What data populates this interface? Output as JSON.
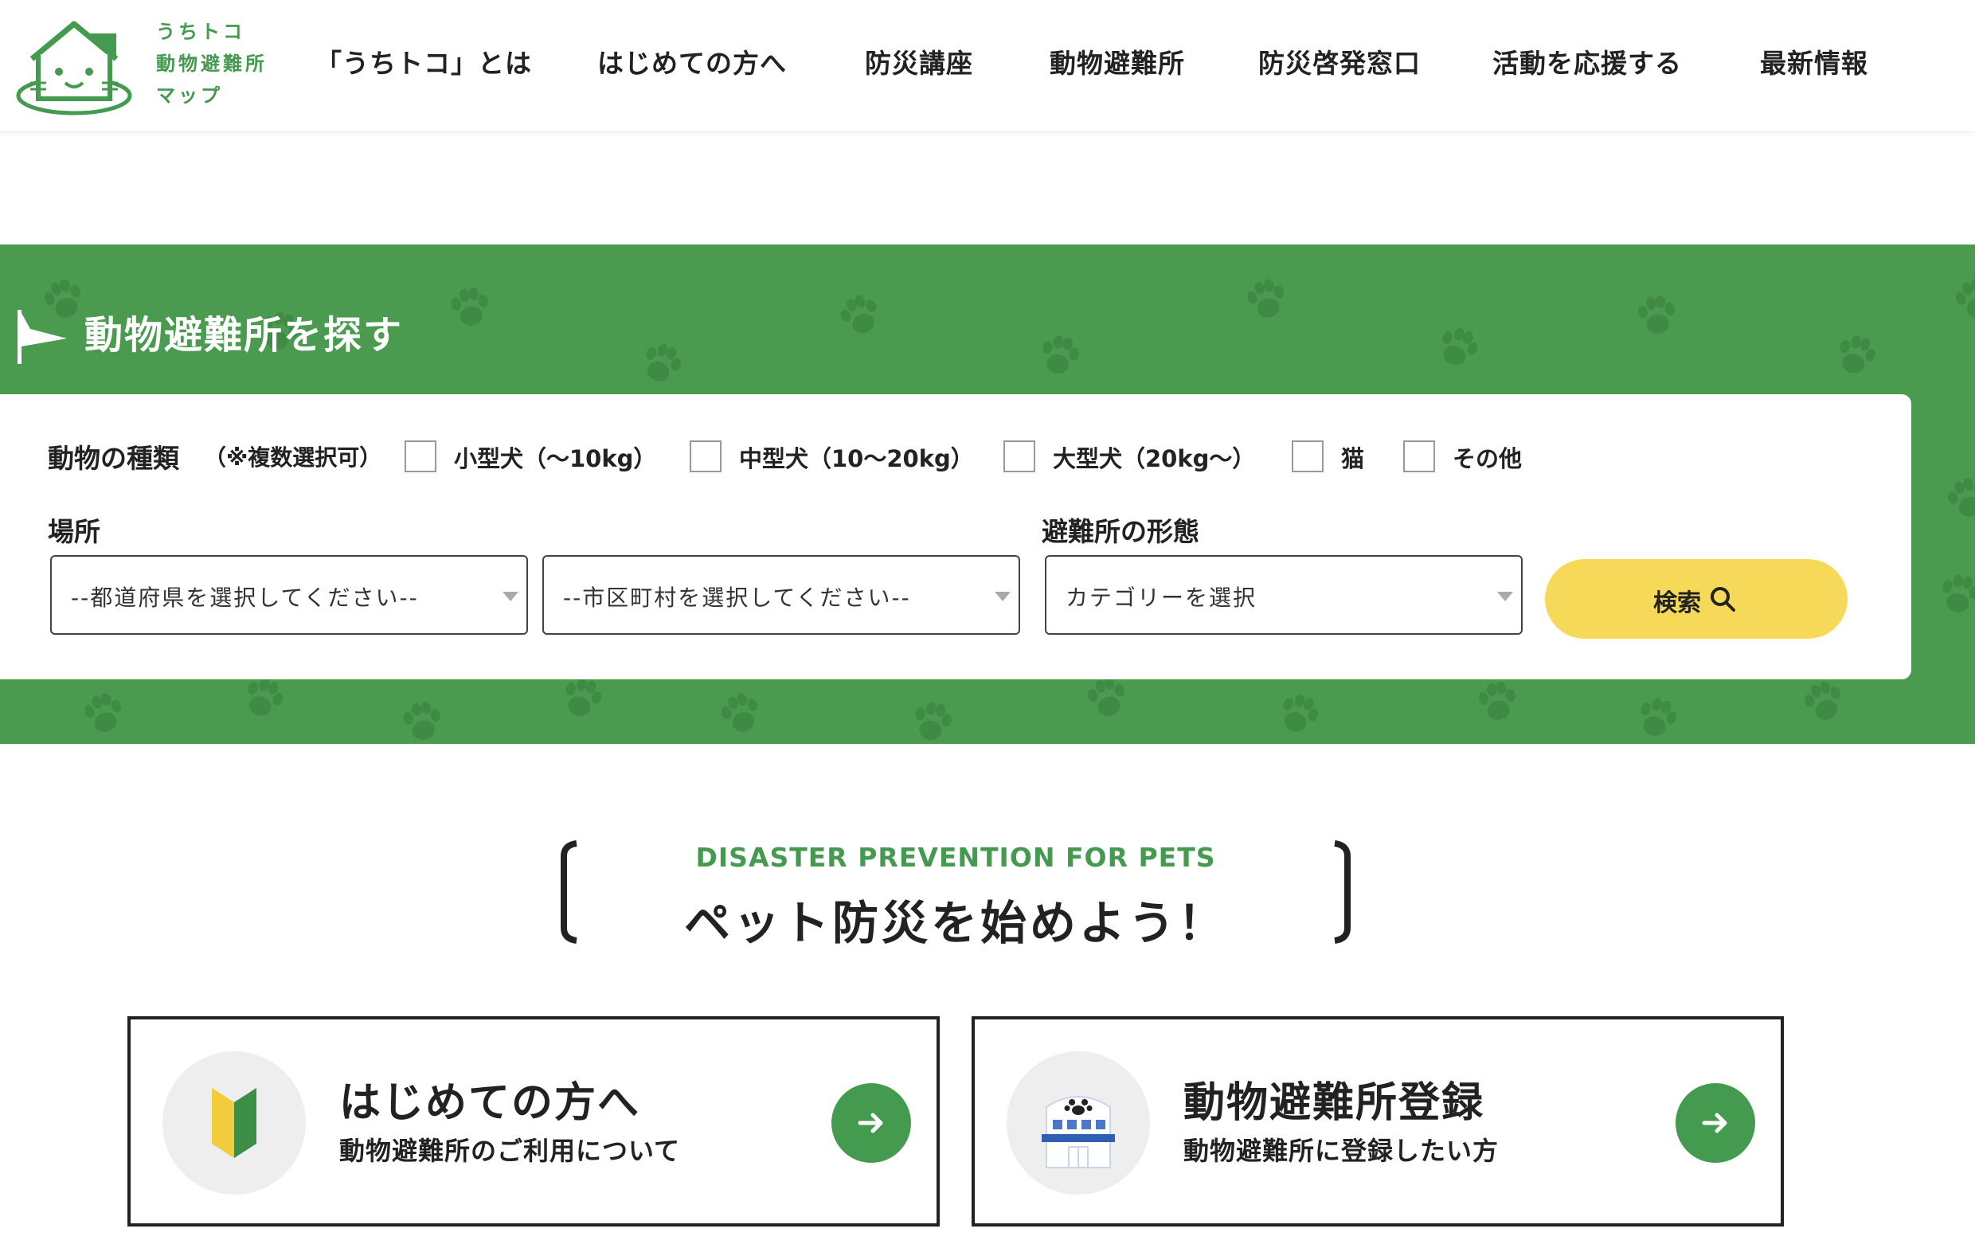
{
  "brand": {
    "logo_lines": [
      "うちトコ",
      "動物避難所",
      "マップ"
    ],
    "color": "#449a4e"
  },
  "nav": {
    "items": [
      {
        "label": "「うちトコ」とは"
      },
      {
        "label": "はじめての方へ"
      },
      {
        "label": "防災講座"
      },
      {
        "label": "動物避難所"
      },
      {
        "label": "防災啓発窓口"
      },
      {
        "label": "活動を応援する"
      },
      {
        "label": "最新情報"
      }
    ]
  },
  "search": {
    "title": "動物避難所を探す",
    "band_color": "#4a9a4f",
    "animal_label": "動物の種類",
    "animal_note": "（※複数選択可）",
    "animal_options": [
      {
        "label": "小型犬（〜10kg）",
        "checked": false
      },
      {
        "label": "中型犬（10〜20kg）",
        "checked": false
      },
      {
        "label": "大型犬（20kg〜）",
        "checked": false
      },
      {
        "label": "猫",
        "checked": false
      },
      {
        "label": "その他",
        "checked": false
      }
    ],
    "location_label": "場所",
    "prefecture_select": "--都道府県を選択してください--",
    "city_select": "--市区町村を選択してください--",
    "type_label": "避難所の形態",
    "category_select": "カテゴリーを選択",
    "button_label": "検索",
    "button_color": "#f7d95a"
  },
  "section": {
    "subtitle": "DISASTER PREVENTION FOR PETS",
    "title": "ペット防災を始めよう！"
  },
  "cards": [
    {
      "title": "はじめての方へ",
      "subtitle": "動物避難所のご利用について",
      "icon": "beginner-leaf-icon"
    },
    {
      "title": "動物避難所登録",
      "subtitle": "動物避難所に登録したい方",
      "icon": "shelter-building-icon"
    }
  ]
}
